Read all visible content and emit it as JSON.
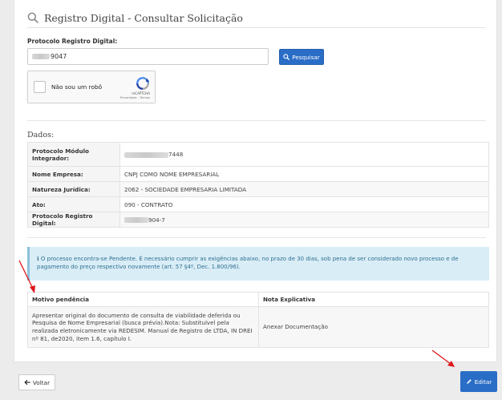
{
  "page": {
    "title": "Registro Digital - Consultar Solicitação"
  },
  "search": {
    "label": "Protocolo Registro Digital:",
    "input_value": "9047",
    "button_label": "Pesquisar"
  },
  "captcha": {
    "label": "Não sou um robô",
    "brand": "reCAPTCHA",
    "links": "Privacidade - Termos"
  },
  "dados": {
    "title": "Dados:",
    "rows": [
      {
        "key": "Protocolo Módulo Integrador:",
        "value": "7448"
      },
      {
        "key": "Nome Empresa:",
        "value": "CNPJ COMO NOME EMPRESARIAL"
      },
      {
        "key": "Natureza Jurídica:",
        "value": "2062 - SOCIEDADE EMPRESARIA LIMITADA"
      },
      {
        "key": "Ato:",
        "value": "090 - CONTRATO"
      },
      {
        "key": "Protocolo Registro Digital:",
        "value": "904-7"
      }
    ]
  },
  "alert": {
    "text": "O processo encontra-se Pendente. É necessário cumprir as exigências abaixo, no prazo de 30 dias, sob pena de ser considerado novo processo e de pagamento do preço respectivo novamente (art. 57 §4º, Dec. 1.800/96)."
  },
  "pendencias": {
    "headers": [
      "Motivo pendência",
      "Nota Explicativa"
    ],
    "rows": [
      {
        "motivo": "Apresentar original do documento de consulta de viabilidade deferida ou Pesquisa de Nome Empresarial (busca prévia).Nota: Substituível pela realizada eletronicamente via REDESIM. Manual de Registro de LTDA, IN DREI nº 81, de2020, item 1.6, capítulo I.",
        "nota": "Anexar Documentação"
      }
    ]
  },
  "footer": {
    "back_label": "Voltar",
    "edit_label": "Editar"
  },
  "colors": {
    "primary": "#2a6dc7",
    "alert_bg": "#d9edf7",
    "alert_text": "#31708f",
    "arrow": "#e0161b"
  }
}
